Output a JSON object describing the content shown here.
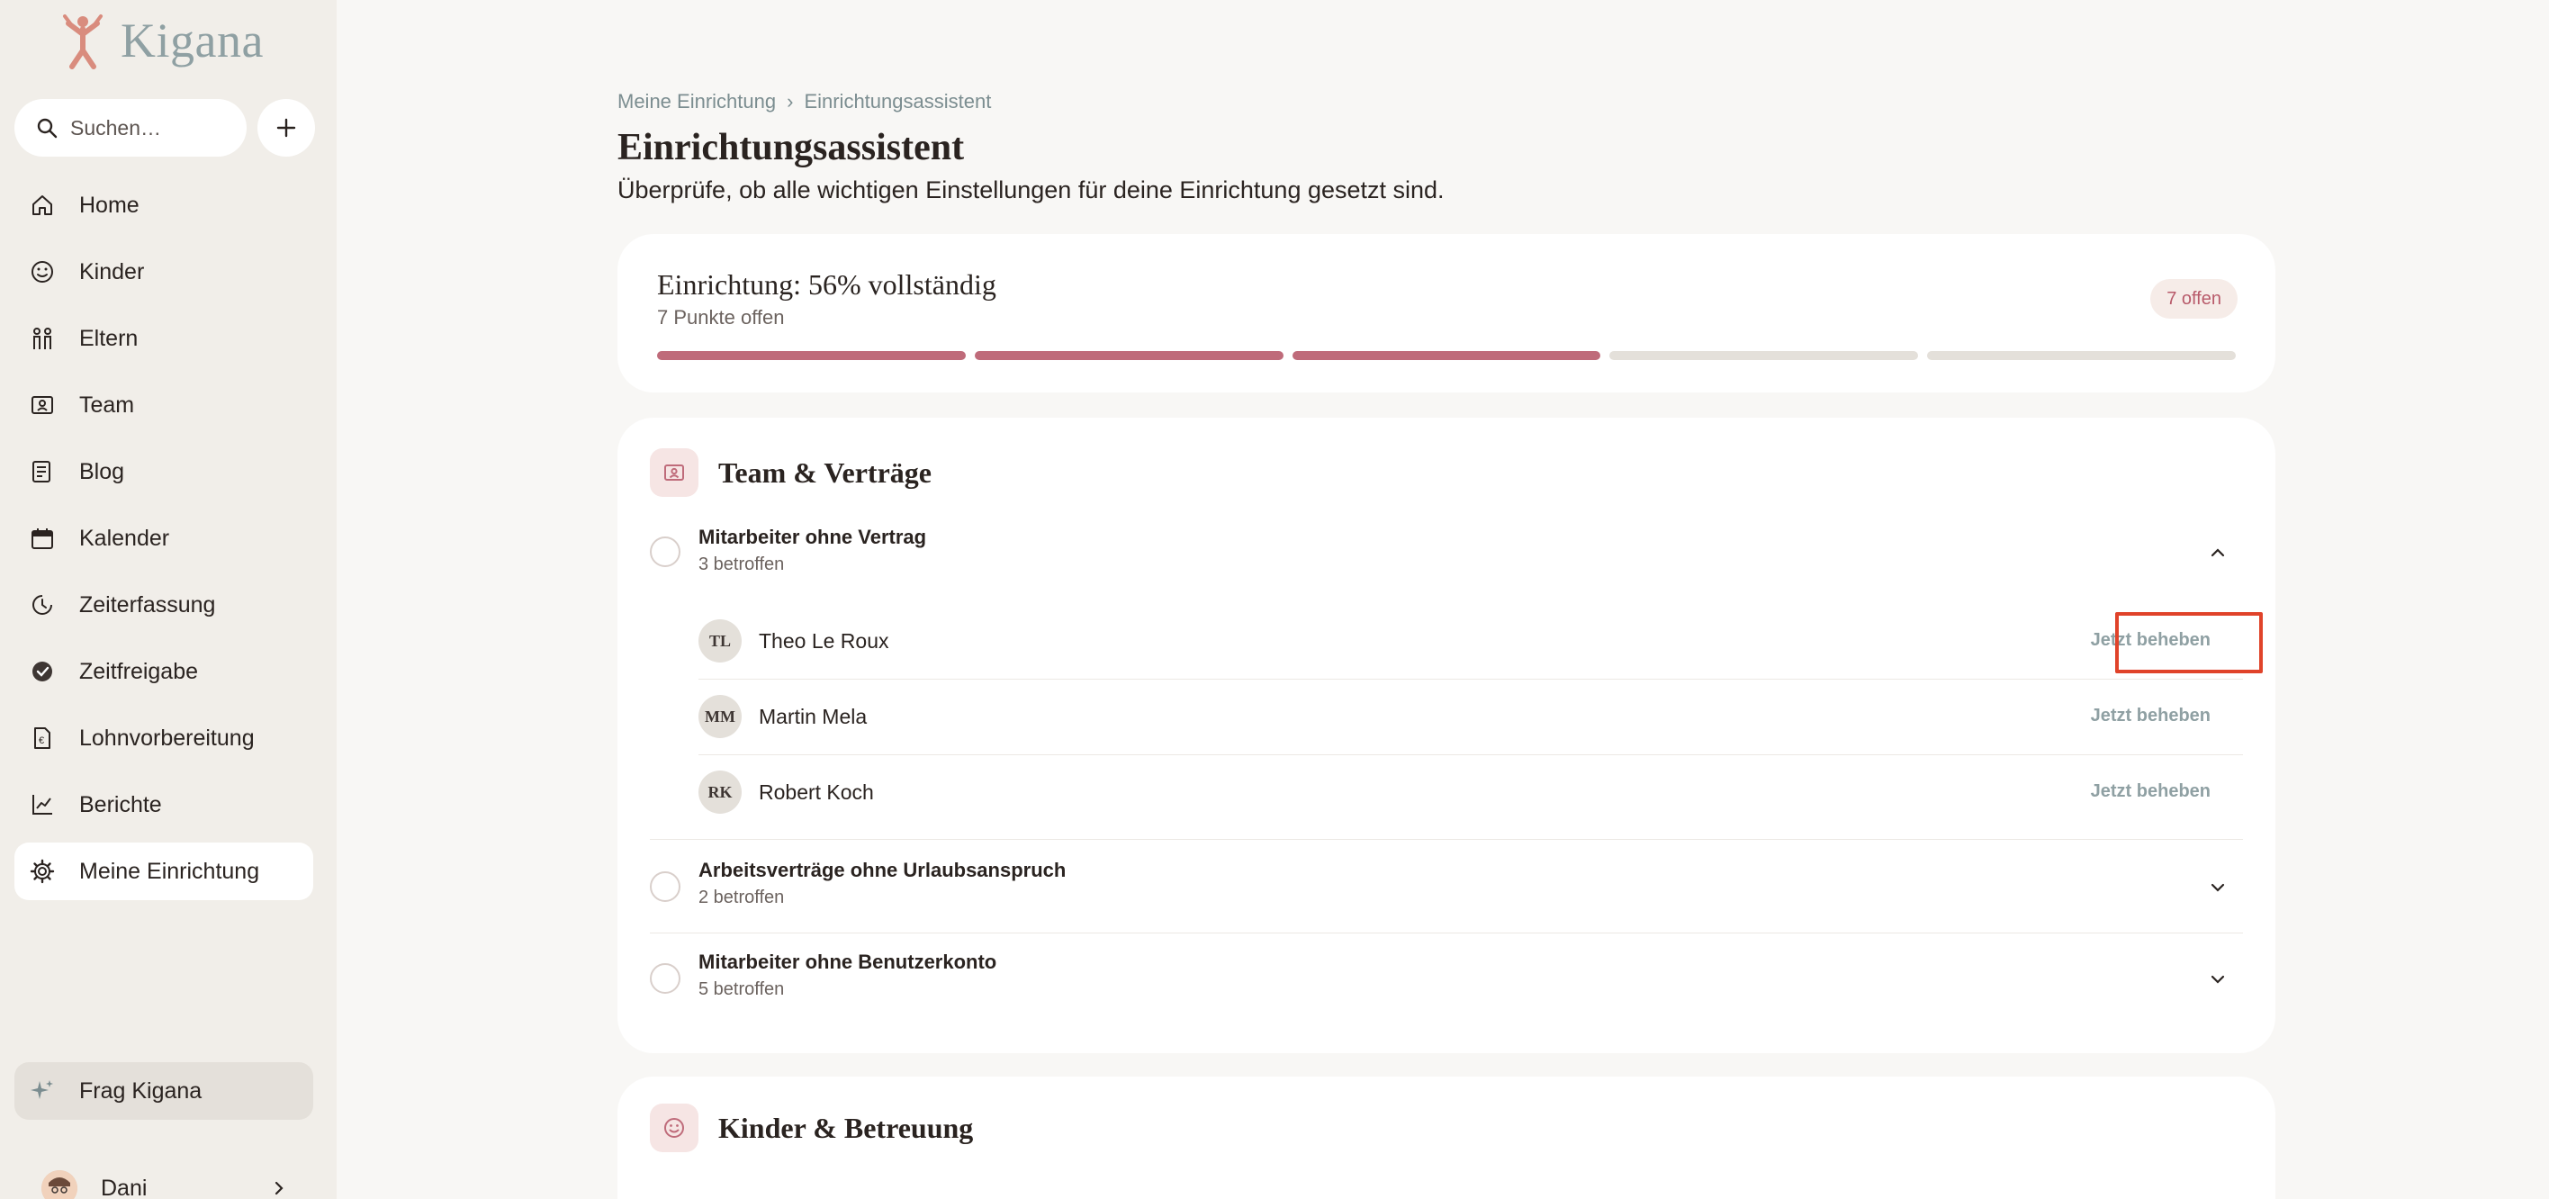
{
  "app": {
    "name": "Kigana"
  },
  "sidebar": {
    "search_placeholder": "Suchen…",
    "items": [
      {
        "label": "Home",
        "icon": "home-icon"
      },
      {
        "label": "Kinder",
        "icon": "smiley-icon"
      },
      {
        "label": "Eltern",
        "icon": "family-icon"
      },
      {
        "label": "Team",
        "icon": "team-icon"
      },
      {
        "label": "Blog",
        "icon": "blog-icon"
      },
      {
        "label": "Kalender",
        "icon": "calendar-icon"
      },
      {
        "label": "Zeiterfassung",
        "icon": "clock-icon"
      },
      {
        "label": "Zeitfreigabe",
        "icon": "check-circle-icon"
      },
      {
        "label": "Lohnvorbereitung",
        "icon": "payroll-icon"
      },
      {
        "label": "Berichte",
        "icon": "chart-icon"
      },
      {
        "label": "Meine Einrichtung",
        "icon": "gear-icon",
        "active": true
      }
    ],
    "ask_label": "Frag Kigana",
    "user_name": "Dani"
  },
  "breadcrumb": {
    "parent": "Meine Einrichtung",
    "current": "Einrichtungsassistent"
  },
  "page": {
    "title": "Einrichtungsassistent",
    "subtitle": "Überprüfe, ob alle wichtigen Einstellungen für deine Einrichtung gesetzt sind."
  },
  "progress": {
    "title": "Einrichtung: 56% vollständig",
    "subtitle": "7 Punkte offen",
    "badge": "7 offen",
    "segments_total": 5,
    "segments_filled": 3,
    "accent": "#bf6b7a"
  },
  "sections": [
    {
      "title": "Team & Verträge",
      "icon": "team-icon",
      "items": [
        {
          "title": "Mitarbeiter ohne Vertrag",
          "subtitle": "3 betroffen",
          "expanded": true,
          "people": [
            {
              "initials": "TL",
              "name": "Theo Le Roux",
              "action": "Jetzt beheben"
            },
            {
              "initials": "MM",
              "name": "Martin Mela",
              "action": "Jetzt beheben"
            },
            {
              "initials": "RK",
              "name": "Robert Koch",
              "action": "Jetzt beheben"
            }
          ]
        },
        {
          "title": "Arbeitsverträge ohne Urlaubsanspruch",
          "subtitle": "2 betroffen",
          "expanded": false
        },
        {
          "title": "Mitarbeiter ohne Benutzerkonto",
          "subtitle": "5 betroffen",
          "expanded": false
        }
      ]
    },
    {
      "title": "Kinder & Betreuung",
      "icon": "smiley-icon"
    }
  ]
}
